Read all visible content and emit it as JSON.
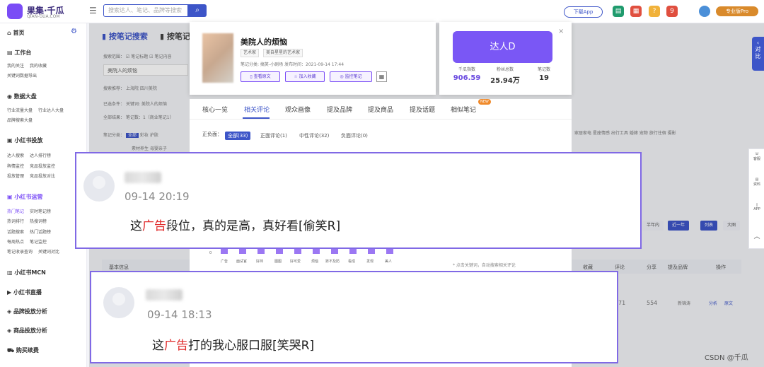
{
  "topbar": {
    "logo_text": "果集·千瓜",
    "logo_sub": "QIAN-GUA.COM",
    "search_placeholder": "搜索达人、笔记、品牌等搜索",
    "download_app": "下载App",
    "notification_count": "9",
    "pro_label": "专业版Pro"
  },
  "sidebar": {
    "home": "首页",
    "workbench": "工作台",
    "workbench_items": [
      "我的关注",
      "我的收藏"
    ],
    "workbench_export": "关键词数据导出",
    "data_screen": "数据大盘",
    "data_items": [
      "行业流量大盘",
      "行业达人大盘"
    ],
    "brand_rank": "品牌搜索大盘",
    "xhs_ads": "小红书投放",
    "ads_items_1": [
      "达人搜索",
      "达人排行榜"
    ],
    "ads_items_2": [
      "舆情监控",
      "竞品投放监控"
    ],
    "ads_items_3": [
      "投放管理",
      "竞品投放对比"
    ],
    "xhs_ops": "小红书运营",
    "ops_items_1": [
      "热门笔记",
      "实时笔记榜"
    ],
    "ops_items_2": [
      "热词排行",
      "热搜词榜"
    ],
    "ops_items_3": [
      "话题搜索",
      "热门话题榜"
    ],
    "ops_items_4": [
      "每周热点",
      "笔记监控"
    ],
    "ops_items_5": [
      "笔记收录查询",
      "关键词对比"
    ],
    "mcn": "小红书MCN",
    "live": "小红书直播",
    "brand_analysis": "品牌投放分析",
    "product_analysis": "商品投放分析",
    "purchase": "购买续费"
  },
  "main": {
    "tab_note_search": "按笔记搜索",
    "tab_note_other": "按笔记",
    "scope_label": "搜索范围：",
    "scope_opts": [
      "笔记标题",
      "笔记内容"
    ],
    "search_value": "美院人的烦恼",
    "recommend_label": "搜索推荐：",
    "recommend_items": [
      "上海院",
      "四川美院"
    ],
    "selected_label": "已选条件：",
    "selected_value": "关键词: 美院人的烦恼",
    "total_label": "全部结果：",
    "total_value": "笔记数：1（商业笔记1）",
    "category_label": "笔记分类：",
    "category_all": "全部",
    "category_items": [
      "彩妆",
      "护肤"
    ],
    "category_items_2": [
      "素材养生",
      "母婴亲子"
    ],
    "right_categories": [
      "家居家电",
      "星座情感",
      "出行工具",
      "婚嫁",
      "宠物",
      "旅行住宿",
      "摄影"
    ],
    "range_buttons": [
      "半年内",
      "近一年"
    ],
    "view_buttons": [
      "列表",
      "大图"
    ],
    "table_headers": [
      "基本信息",
      "收藏",
      "评论",
      "分享",
      "提及品牌",
      "操作"
    ],
    "row_values": [
      "71",
      "554"
    ],
    "row_tag": "新锦涛",
    "row_actions": [
      "分析",
      "原文"
    ]
  },
  "detail_card": {
    "title": "美院人的烦恼",
    "tags": [
      "艺术家",
      "美自星星的艺术家"
    ],
    "meta": "笔记分类: 搞笑-小剧场    发布时间：2021-09-14 17:44",
    "buttons": [
      "查看原文",
      "加入收藏",
      "监控笔记"
    ],
    "qr_icon": "qr-code-icon"
  },
  "expert_card": {
    "button": "达人D",
    "stats": [
      {
        "label": "千瓜指数",
        "value": "906.59",
        "color": "#6a4ae0"
      },
      {
        "label": "粉丝总数",
        "value": "25.94万",
        "color": "#222222"
      },
      {
        "label": "笔记数",
        "value": "19",
        "color": "#222222"
      }
    ]
  },
  "modal": {
    "tabs": [
      "核心一览",
      "相关评论",
      "观众画像",
      "提及品牌",
      "提及商品",
      "提及话题",
      "相似笔记"
    ],
    "active_tab": "相关评论",
    "new_badge": "NEW",
    "sentiment_label": "正负面：",
    "sentiment_chips": [
      "全部(33)",
      "正面评论(1)",
      "中性评论(32)",
      "负面评论(0)"
    ],
    "chart_zero": "0",
    "chart_words": [
      "广告",
      "面试官",
      "好帅",
      "图图",
      "好可爱",
      "烦恼",
      "猝不及防",
      "看成",
      "发现",
      "美人"
    ],
    "hint": "* 点击关键词，自动搜索相关评论"
  },
  "comments": [
    {
      "time": "09-14 20:19",
      "pre": "这",
      "highlight": "广告",
      "post": "段位，真的是高，真好看[偷笑R]"
    },
    {
      "time": "09-14 18:13",
      "pre": "这",
      "highlight": "广告",
      "post": "打的我心服口服[笑哭R]"
    }
  ],
  "side": {
    "compare_tab": "对比",
    "float_items": [
      "客服",
      "资料",
      "APP"
    ]
  },
  "watermark": "CSDN @千瓜",
  "colors": {
    "brand_blue": "#3d55c8",
    "brand_purple": "#7a57f5",
    "highlight_red": "#e02a2a",
    "comment_border": "#8069e5"
  }
}
